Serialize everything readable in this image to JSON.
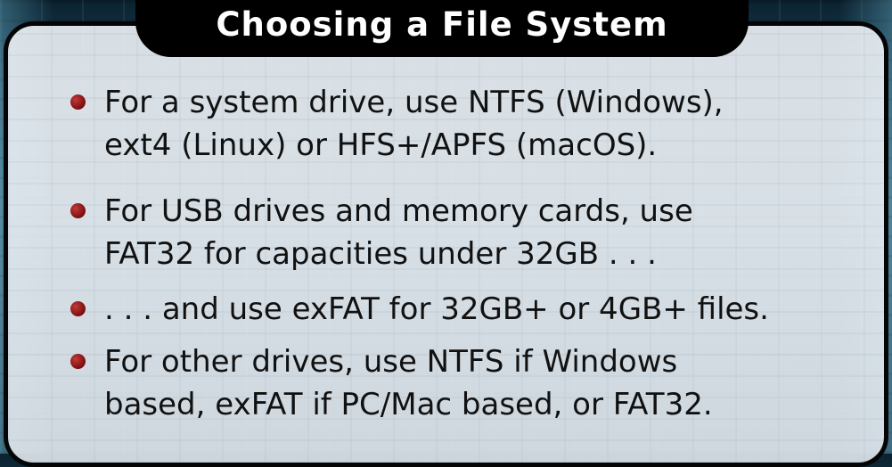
{
  "slide": {
    "title": "Choosing a File System",
    "bullets": [
      {
        "lines": [
          "For a system drive, use NTFS (Windows),",
          "ext4 (Linux) or HFS+/APFS (macOS)."
        ]
      },
      {
        "lines": [
          "For USB drives and memory cards, use",
          "FAT32 for capacities under 32GB . . ."
        ]
      },
      {
        "lines": [
          ". . . and use exFAT for 32GB+ or 4GB+ files."
        ]
      },
      {
        "lines": [
          "For other drives, use NTFS if Windows",
          "based, exFAT if PC/Mac based, or FAT32."
        ]
      }
    ]
  },
  "colors": {
    "bullet_dot": "#7a0d0d",
    "title_bar": "#000000",
    "title_text": "#ffffff",
    "panel_bg": "#e6ebf0"
  }
}
